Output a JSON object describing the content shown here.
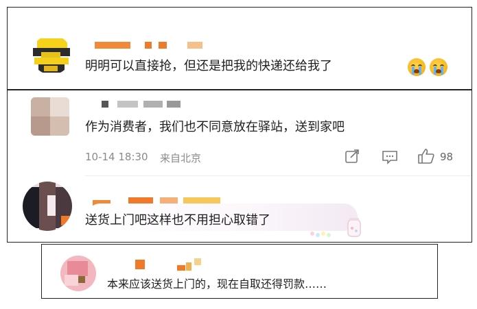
{
  "comments": [
    {
      "text": "明明可以直接抢，但还是把我的快递还给我了",
      "emoji": [
        "crying-emoji",
        "crying-emoji"
      ]
    },
    {
      "text": "作为消费者，我们也不同意放在驿站，送到家吧",
      "meta": {
        "time": "10-14 18:30",
        "location": "来自北京",
        "likes": "98"
      }
    },
    {
      "text": "送货上门吧这样也不用担心取错了"
    },
    {
      "text": "本来应该送货上门的，现在自取还得罚款……"
    }
  ],
  "colors": {
    "name_orange": "#f08a3a",
    "name_peach": "#f7c08a",
    "name_gray": "#c4c4c4",
    "meta_gray": "#8a8a8a"
  },
  "icons": [
    "share-icon",
    "comment-icon",
    "like-icon"
  ]
}
